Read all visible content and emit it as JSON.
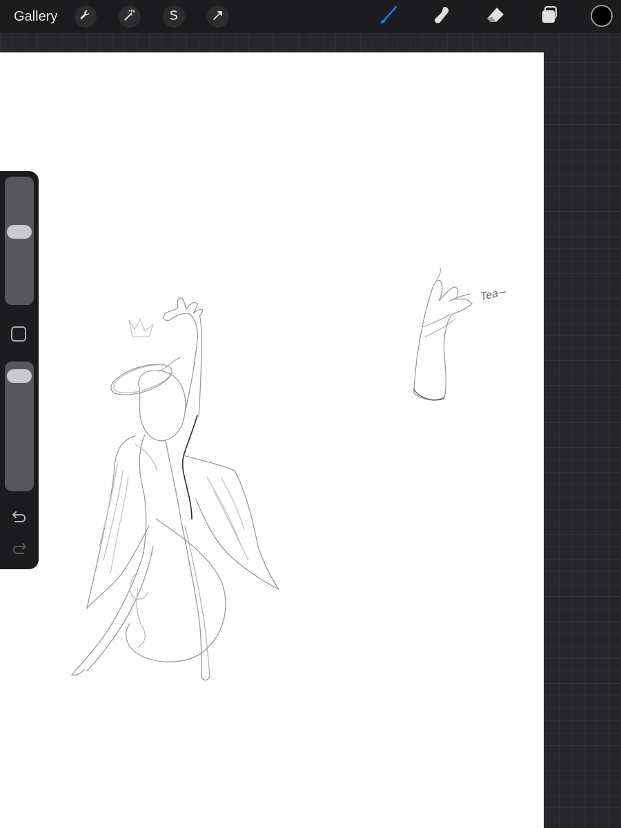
{
  "app": {
    "gallery_label": "Gallery"
  },
  "toolbar": {
    "left_tools": [
      {
        "name": "actions",
        "icon": "wrench-icon"
      },
      {
        "name": "adjustments",
        "icon": "magic-wand-icon"
      },
      {
        "name": "selection",
        "icon": "selection-s-icon"
      },
      {
        "name": "transform",
        "icon": "arrow-cursor-icon"
      }
    ],
    "right_tools": [
      {
        "name": "brush",
        "icon": "brush-icon",
        "active": true
      },
      {
        "name": "smudge",
        "icon": "smudge-icon",
        "active": false
      },
      {
        "name": "eraser",
        "icon": "eraser-icon",
        "active": false
      },
      {
        "name": "layers",
        "icon": "layers-icon",
        "active": false
      }
    ],
    "current_color": "#000000",
    "active_color": "#1a73e8"
  },
  "sidebar": {
    "brush_size_level": 0.58,
    "opacity_level": 0.95,
    "undo_icon": "undo-icon",
    "redo_icon": "redo-icon",
    "modify_icon": "square-modify-icon"
  },
  "canvas": {
    "annotation_text": "Tea~",
    "background": "#ffffff"
  }
}
